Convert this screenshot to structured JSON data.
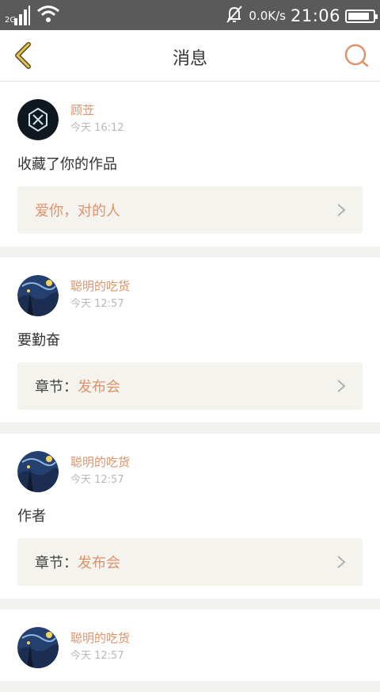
{
  "status_bar": {
    "network_type": "2G",
    "speed": "0.0K/s",
    "clock": "21:06",
    "battery_level": 0.85,
    "icons": [
      "signal-icon",
      "wifi-icon",
      "alarm-off-icon",
      "battery-icon"
    ]
  },
  "nav": {
    "title": "消息",
    "back_icon": "chevron-left-icon",
    "search_icon": "search-icon"
  },
  "colors": {
    "accent": "#e0926a",
    "back_arrow": "#e6c64a",
    "status_bar_bg": "#5a5a5a",
    "quote_bg": "#f4f3ee"
  },
  "messages": [
    {
      "user": "顾苙",
      "time": "今天 16:12",
      "text": "收藏了你的作品",
      "quote_label": "",
      "quote_text": "爱你，对的人",
      "avatar": "exo-logo-avatar"
    },
    {
      "user": "聪明的吃货",
      "time": "今天 12:57",
      "text": "要勤奋",
      "quote_label": "章节：",
      "quote_text": "发布会",
      "avatar": "starry-night-avatar"
    },
    {
      "user": "聪明的吃货",
      "time": "今天 12:57",
      "text": "作者",
      "quote_label": "章节：",
      "quote_text": "发布会",
      "avatar": "starry-night-avatar"
    },
    {
      "user": "聪明的吃货",
      "time": "今天 12:57",
      "text": "",
      "quote_label": "",
      "quote_text": "",
      "avatar": "starry-night-avatar"
    }
  ]
}
